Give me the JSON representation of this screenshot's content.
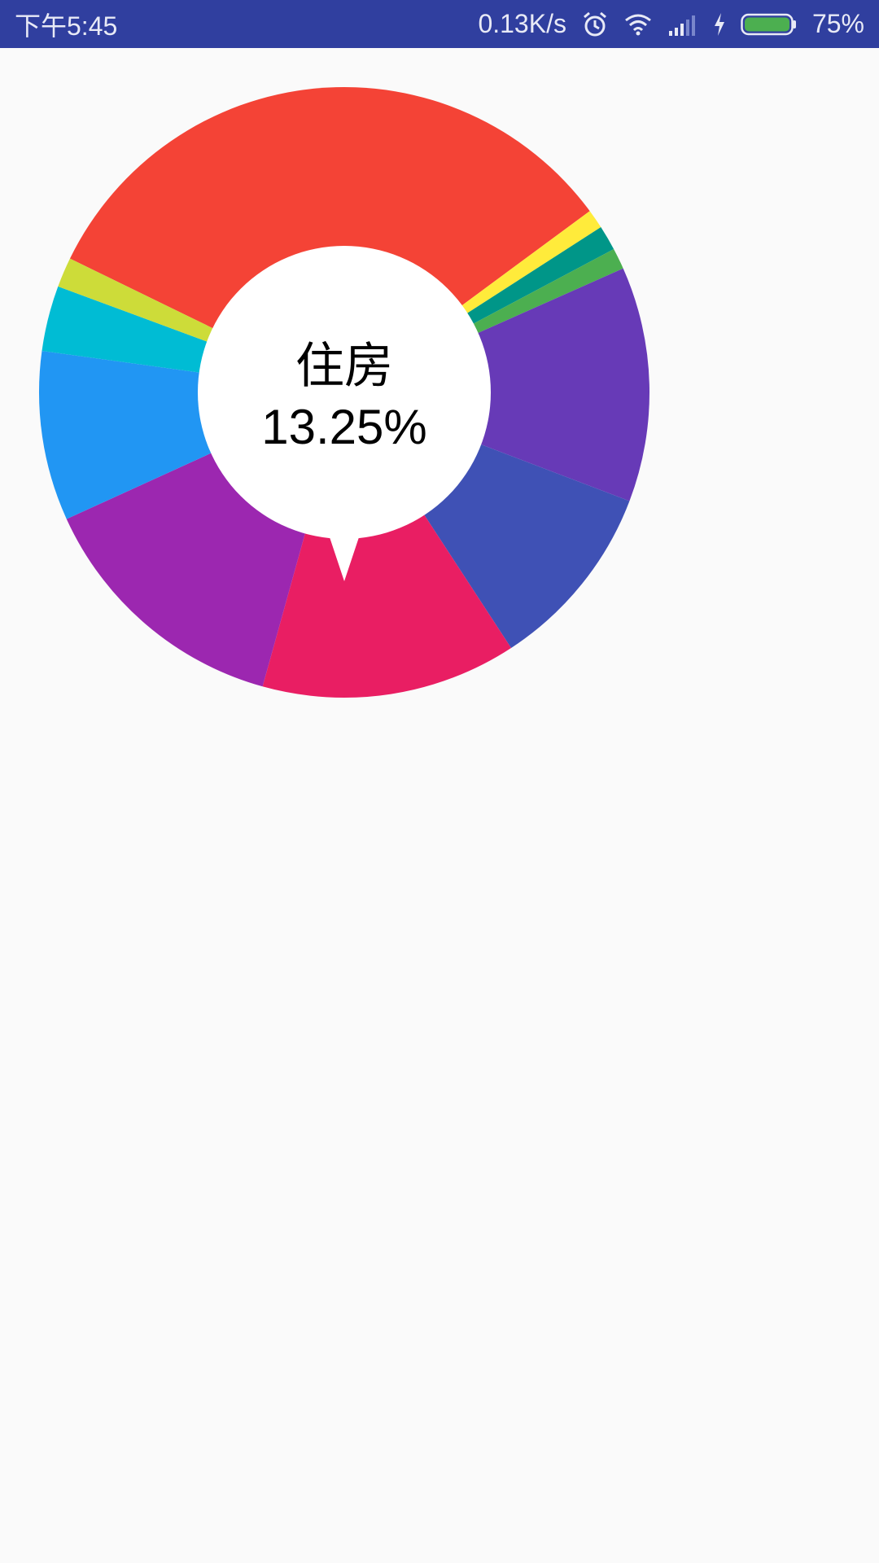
{
  "status_bar": {
    "time": "下午5:45",
    "net_speed": "0.13K/s",
    "battery_percent": "75%",
    "battery_level": 0.75,
    "icons": [
      "alarm-icon",
      "wifi-icon",
      "signal-icon",
      "charging-icon",
      "battery-icon"
    ],
    "background_color": "#303f9f"
  },
  "chart_data": {
    "type": "pie",
    "style": "donut",
    "selected": {
      "label": "住房",
      "value_text": "13.25%"
    },
    "slices": [
      {
        "value": 32.0,
        "color": "#f44336"
      },
      {
        "value": 1.0,
        "color": "#ffeb3b"
      },
      {
        "value": 1.3,
        "color": "#009688"
      },
      {
        "value": 1.1,
        "color": "#4caf50"
      },
      {
        "value": 12.2,
        "color": "#673ab7"
      },
      {
        "value": 9.8,
        "color": "#3f51b5"
      },
      {
        "value": 13.25,
        "color": "#e91e63"
      },
      {
        "value": 13.6,
        "color": "#9c27b0"
      },
      {
        "value": 8.8,
        "color": "#2196f3"
      },
      {
        "value": 3.4,
        "color": "#00bcd4"
      },
      {
        "value": 1.55,
        "color": "#cddc39"
      }
    ]
  }
}
